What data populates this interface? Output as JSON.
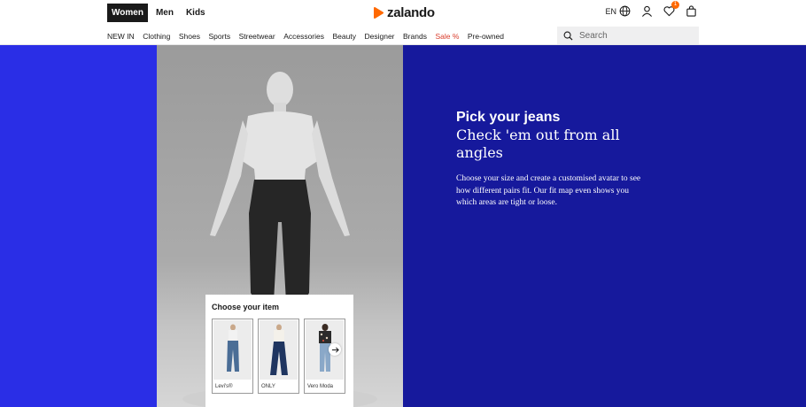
{
  "header": {
    "gender_tabs": [
      {
        "label": "Women",
        "active": true
      },
      {
        "label": "Men",
        "active": false
      },
      {
        "label": "Kids",
        "active": false
      }
    ],
    "logo_text": "zalando",
    "language": "EN",
    "wishlist_count": "1",
    "icons": [
      "globe-icon",
      "user-icon",
      "heart-icon",
      "bag-icon"
    ]
  },
  "nav": {
    "items": [
      "NEW IN",
      "Clothing",
      "Shoes",
      "Sports",
      "Streetwear",
      "Accessories",
      "Beauty",
      "Designer",
      "Brands",
      "Sale %",
      "Pre-owned"
    ],
    "search_placeholder": "Search"
  },
  "hero": {
    "title": "Pick your jeans",
    "subtitle": "Check 'em out from all angles",
    "body": "Choose your size and create a customised avatar to see how different pairs fit. Our fit map even shows you which areas are tight or loose."
  },
  "chooser": {
    "title": "Choose your item",
    "items": [
      {
        "brand": "Levi's®"
      },
      {
        "brand": "ONLY"
      },
      {
        "brand": "Vero Moda"
      }
    ]
  },
  "colors": {
    "brand_orange": "#ff6900",
    "hero_left_blue": "#2a2ee6",
    "hero_right_navy": "#16199c",
    "sale_red": "#d93c2b"
  }
}
